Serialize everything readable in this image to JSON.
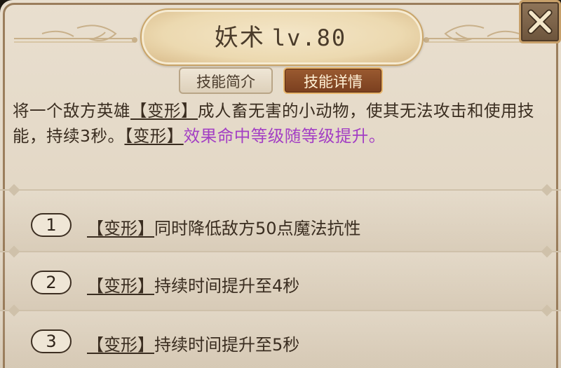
{
  "skill": {
    "name": "妖术",
    "level": "lv.80"
  },
  "tabs": {
    "intro": "技能简介",
    "detail": "技能详情",
    "active": "detail"
  },
  "description": {
    "part1": "将一个敌方英雄",
    "keyword1": "【变形】",
    "part2": "成人畜无害的小动物，使其无法攻击和使用技能，持续3秒。",
    "keyword2": "【变形】",
    "part3_purple": "效果命中等级随等级提升。"
  },
  "upgrades": [
    {
      "number": "1",
      "keyword": "【变形】",
      "text": "同时降低敌方50点魔法抗性"
    },
    {
      "number": "2",
      "keyword": "【变形】",
      "text": "持续时间提升至4秒"
    },
    {
      "number": "3",
      "keyword": "【变形】",
      "text": "持续时间提升至5秒"
    }
  ],
  "icons": {
    "close": "close-x-icon",
    "ornament": "ornament-icon"
  },
  "colors": {
    "panel_bg": "#e6dccb",
    "active_tab": "#8a4a25",
    "purple_text": "#a33fc4",
    "text": "#3a2d20"
  }
}
